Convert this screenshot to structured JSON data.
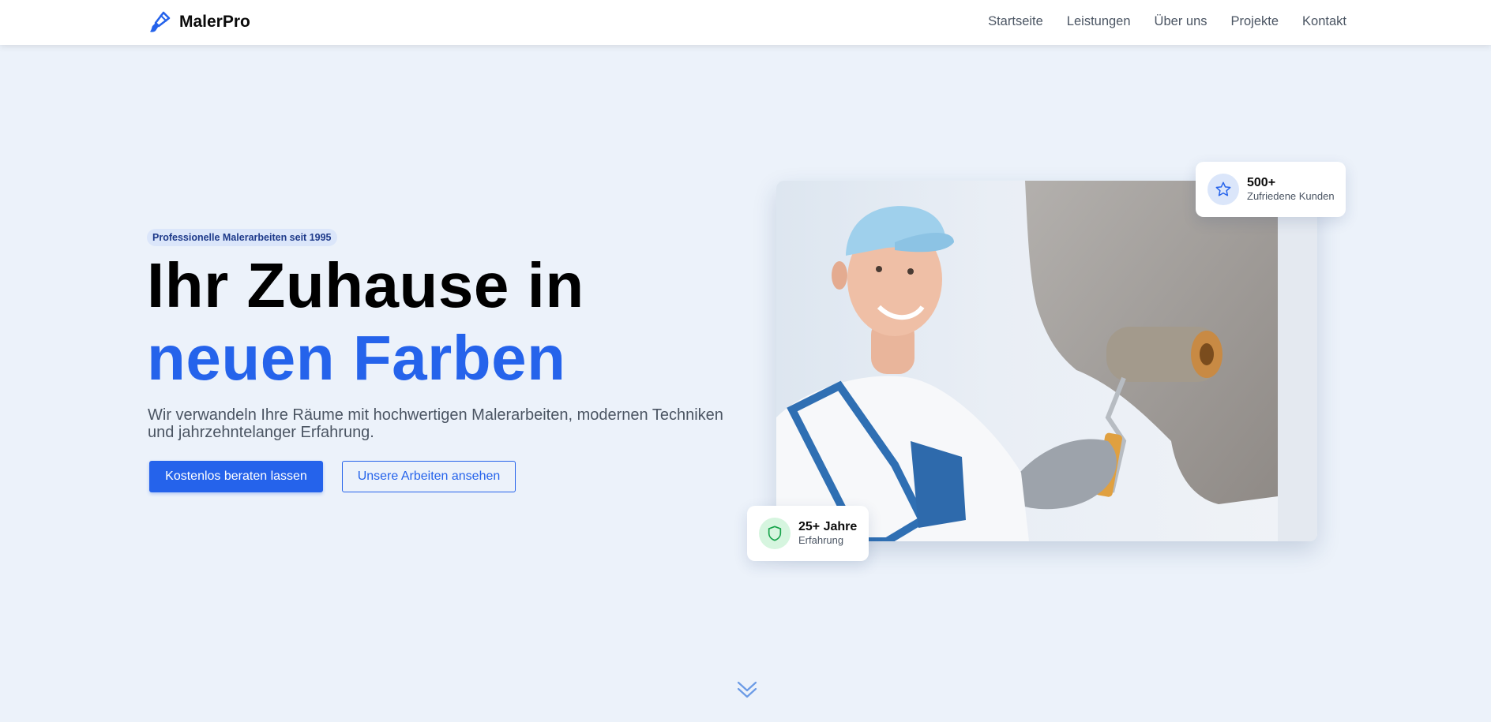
{
  "brand": {
    "name": "MalerPro",
    "logo_icon": "paintbrush-icon",
    "accent": "#2563eb"
  },
  "nav": {
    "links": [
      "Startseite",
      "Leistungen",
      "Über uns",
      "Projekte",
      "Kontakt"
    ]
  },
  "hero": {
    "badge": "Professionelle Malerarbeiten seit 1995",
    "headline_line1": "Ihr Zuhause in",
    "headline_line2": "neuen Farben",
    "subtext": "Wir verwandeln Ihre Räume mit hochwertigen Malerarbeiten, modernen Techniken und jahrzehntelanger Erfahrung.",
    "primary_button": "Kostenlos beraten lassen",
    "secondary_button": "Unsere Arbeiten ansehen"
  },
  "stats": {
    "customers": {
      "value": "500+",
      "label": "Zufriedene Kunden",
      "icon": "star-icon"
    },
    "experience": {
      "value": "25+ Jahre",
      "label": "Erfahrung",
      "icon": "shield-icon"
    }
  },
  "scroll_icon": "chevron-double-down-icon",
  "colors": {
    "background": "#ecf2fa",
    "primary": "#2563eb",
    "headline": "#000000",
    "muted_text": "#4b5563",
    "success": "#16a34a"
  }
}
